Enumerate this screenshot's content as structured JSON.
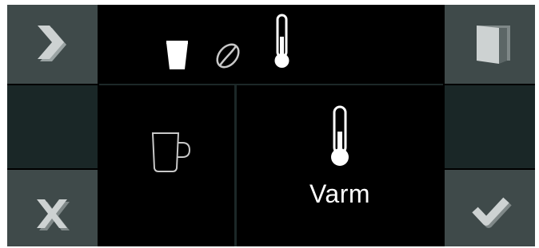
{
  "colors": {
    "button_bg": "#3f4a4a",
    "button_icon": "#cdd2d2",
    "side_dark": "#1a2727",
    "divider": "#1c2828",
    "screen_bg": "#000000",
    "icon_white": "#ffffff",
    "icon_outline": "#c8c8c8"
  },
  "nav": {
    "next": {
      "icon": "chevron-right-icon"
    },
    "cancel": {
      "icon": "close-icon"
    },
    "door": {
      "icon": "door-icon"
    },
    "confirm": {
      "icon": "checkmark-icon"
    }
  },
  "status_bar": {
    "icons": [
      "glass-icon",
      "coffee-bean-icon",
      "thermometer-icon"
    ]
  },
  "options": {
    "cup": {
      "icon": "cup-icon",
      "label": ""
    },
    "temperature": {
      "icon": "thermometer-icon",
      "label": "Varm"
    }
  }
}
